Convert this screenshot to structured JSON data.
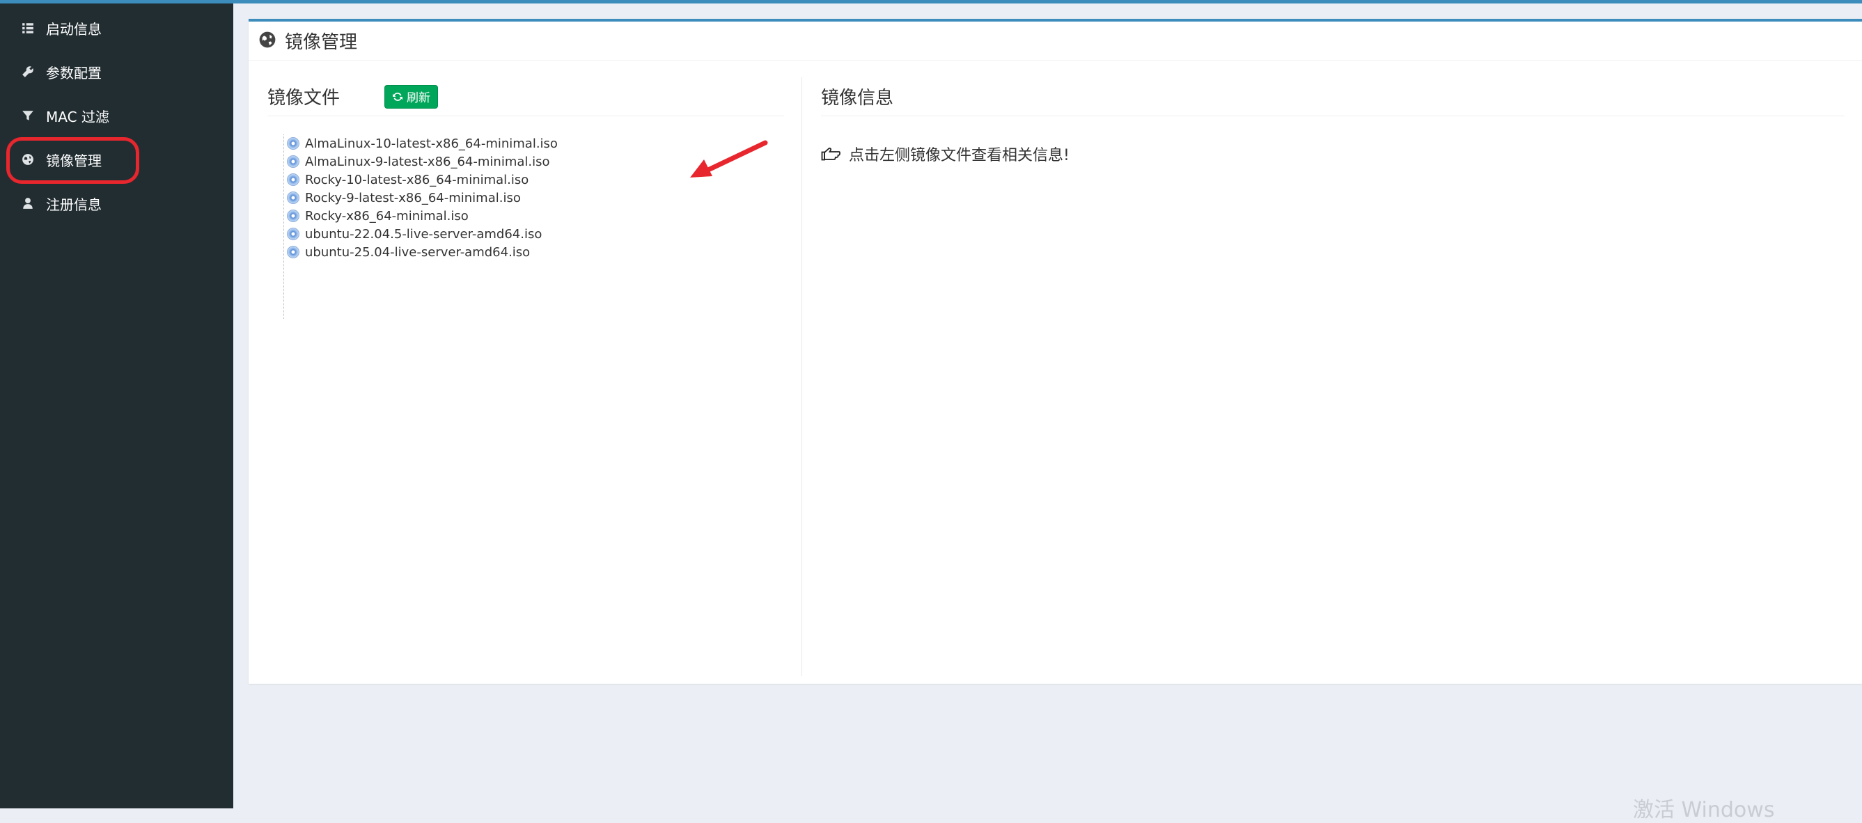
{
  "sidebar": {
    "items": [
      {
        "label": "启动信息",
        "icon": "list-icon"
      },
      {
        "label": "参数配置",
        "icon": "wrench-icon"
      },
      {
        "label": "MAC 过滤",
        "icon": "filter-icon"
      },
      {
        "label": "镜像管理",
        "icon": "globe-icon",
        "active": true
      },
      {
        "label": "注册信息",
        "icon": "user-icon"
      }
    ]
  },
  "page": {
    "title": "镜像管理",
    "title_icon": "globe-icon"
  },
  "files_panel": {
    "title": "镜像文件",
    "refresh_label": "刷新",
    "files": [
      "AlmaLinux-10-latest-x86_64-minimal.iso",
      "AlmaLinux-9-latest-x86_64-minimal.iso",
      "Rocky-10-latest-x86_64-minimal.iso",
      "Rocky-9-latest-x86_64-minimal.iso",
      "Rocky-x86_64-minimal.iso",
      "ubuntu-22.04.5-live-server-amd64.iso",
      "ubuntu-25.04-live-server-amd64.iso"
    ]
  },
  "info_panel": {
    "title": "镜像信息",
    "message": "点击左侧镜像文件查看相关信息!",
    "message_icon": "hand-point-left-icon"
  },
  "watermark": "激活 Windows",
  "colors": {
    "sidebar_bg": "#222d32",
    "accent": "#3c8dbc",
    "refresh_green": "#00a65a",
    "annotation_red": "#e8262d"
  }
}
